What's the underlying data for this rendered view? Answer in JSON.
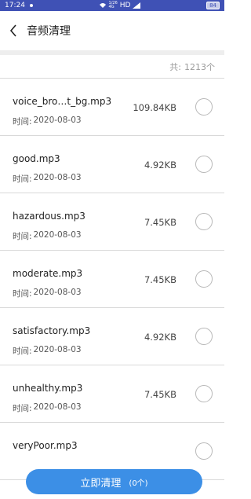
{
  "status_bar": {
    "time": "17:24",
    "network_top": "1/26",
    "network_bottom": "4G",
    "hd": "HD",
    "battery": "84"
  },
  "header": {
    "back_icon": "chevron-left-icon",
    "title": "音频清理"
  },
  "summary": {
    "label": "共:",
    "count": "1213个"
  },
  "time_label": "时间:",
  "files": [
    {
      "name": "voice_bro…t_bg.mp3",
      "date": "2020-08-03",
      "size": "109.84KB"
    },
    {
      "name": "good.mp3",
      "date": "2020-08-03",
      "size": "4.92KB"
    },
    {
      "name": "hazardous.mp3",
      "date": "2020-08-03",
      "size": "7.45KB"
    },
    {
      "name": "moderate.mp3",
      "date": "2020-08-03",
      "size": "7.45KB"
    },
    {
      "name": "satisfactory.mp3",
      "date": "2020-08-03",
      "size": "4.92KB"
    },
    {
      "name": "unhealthy.mp3",
      "date": "2020-08-03",
      "size": "7.45KB"
    },
    {
      "name": "veryPoor.mp3",
      "date": "",
      "size": ""
    }
  ],
  "action": {
    "label": "立即清理",
    "count": "(0个)"
  },
  "colors": {
    "status_bar": "#3f51b5",
    "button": "#3c8fe6"
  }
}
